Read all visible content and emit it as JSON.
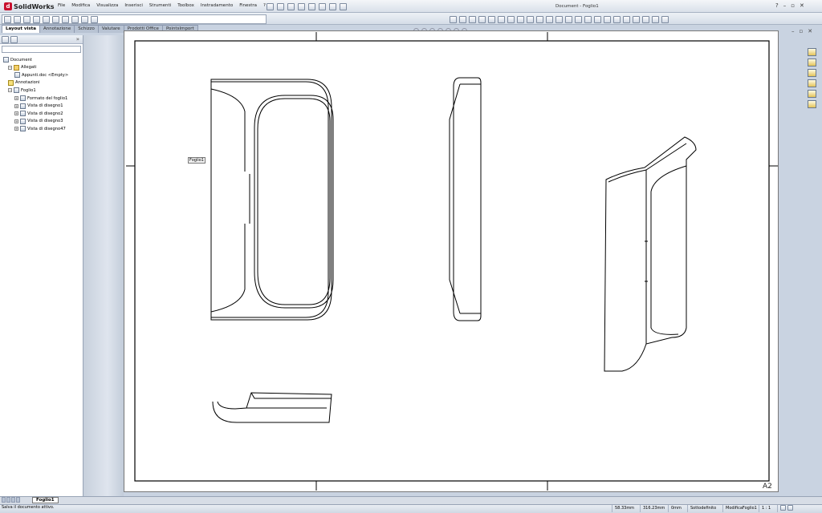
{
  "app": {
    "name": "SolidWorks",
    "menu": [
      "File",
      "Modifica",
      "Visualizza",
      "Inserisci",
      "Strumenti",
      "Toolbox",
      "Instradamento",
      "Finestra",
      "?"
    ],
    "window_title": "Document - Foglio1"
  },
  "command_manager": {
    "tabs": [
      "Layout vista",
      "Annotazione",
      "Schizzo",
      "Valutare",
      "Prodotti Office",
      "PointsImport"
    ],
    "active_tab": "Layout vista"
  },
  "feature_manager": {
    "tree": [
      {
        "label": "Document",
        "icon": "drawing-icon",
        "level": 0,
        "expander": ""
      },
      {
        "label": "Allegati",
        "icon": "attachments-icon",
        "level": 1,
        "expander": "−"
      },
      {
        "label": "Appunti.doc <Empty>",
        "icon": "document-icon",
        "level": 2,
        "expander": ""
      },
      {
        "label": "Annotazioni",
        "icon": "annotation-icon",
        "level": 1,
        "expander": ""
      },
      {
        "label": "Foglio1",
        "icon": "sheet-icon",
        "level": 1,
        "expander": "−"
      },
      {
        "label": "Formato del foglio1",
        "icon": "sheet-format-icon",
        "level": 2,
        "expander": "+"
      },
      {
        "label": "Vista di disegno1",
        "icon": "drawing-view-icon",
        "level": 2,
        "expander": "+"
      },
      {
        "label": "Vista di disegno2",
        "icon": "drawing-view-icon",
        "level": 2,
        "expander": "+"
      },
      {
        "label": "Vista di disegno3",
        "icon": "drawing-view-icon",
        "level": 2,
        "expander": "+"
      },
      {
        "label": "Vista di disegno47",
        "icon": "drawing-view-icon",
        "level": 2,
        "expander": "+"
      }
    ]
  },
  "sheet": {
    "tooltip": "Foglio1",
    "size_label": "A2",
    "tab_label": "Foglio1"
  },
  "status": {
    "message": "Salva il documento attivo.",
    "x": "58.33mm",
    "y": "316.23mm",
    "z": "0mm",
    "state": "Sottodefinito",
    "mode": "ModificaFoglio1",
    "scale": "1 : 1"
  },
  "colors": {
    "background": "#c9d3e1",
    "paper": "#ffffff",
    "line": "#000000",
    "brand": "#c8102e"
  }
}
